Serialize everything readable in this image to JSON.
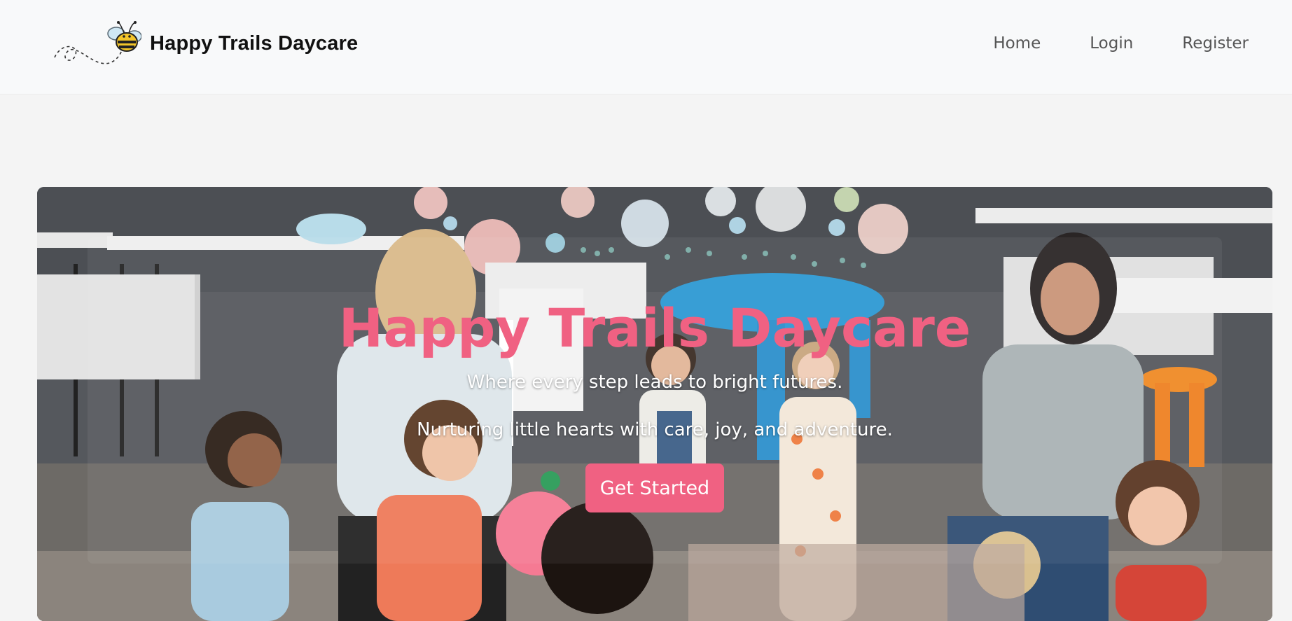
{
  "brand": {
    "name": "Happy Trails Daycare",
    "logo_icon": "bee-icon"
  },
  "nav": {
    "items": [
      {
        "label": "Home"
      },
      {
        "label": "Login"
      },
      {
        "label": "Register"
      }
    ]
  },
  "hero": {
    "title": "Happy Trails Daycare",
    "subtitle": "Where every step leads to bright futures.",
    "tagline": "Nurturing little hearts with care, joy, and adventure.",
    "cta_label": "Get Started"
  },
  "colors": {
    "accent": "#f06182",
    "navbar_bg": "#f8f9fa",
    "page_bg": "#f4f4f4"
  }
}
